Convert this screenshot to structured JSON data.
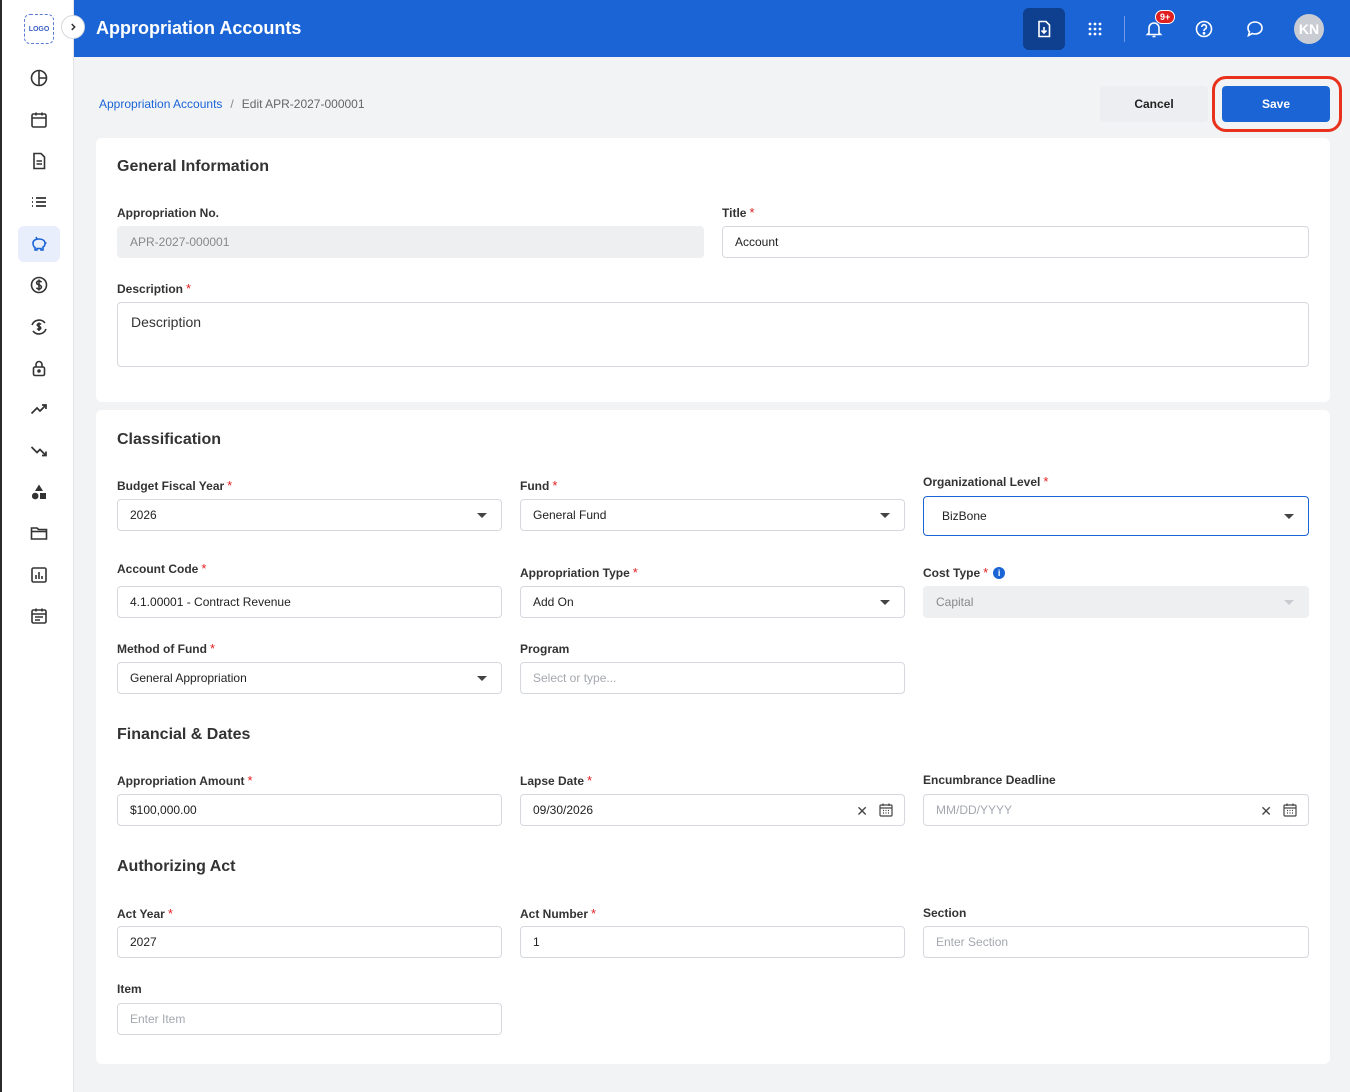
{
  "sidebar": {
    "logo_text": "LOGO",
    "icons": [
      "dashboard-icon",
      "calendar-icon",
      "document-icon",
      "list-icon",
      "piggy-bank-icon",
      "dollar-icon",
      "currency-exchange-icon",
      "lock-icon",
      "trending-up-icon",
      "trending-down-icon",
      "shapes-icon",
      "folder-icon",
      "bar-chart-icon",
      "schedule-icon"
    ],
    "active_index": 4
  },
  "header": {
    "title": "Appropriation Accounts",
    "notification_badge": "9+",
    "avatar_initials": "KN",
    "bg_color": "#1a64d6"
  },
  "breadcrumb": {
    "parent": "Appropriation Accounts",
    "separator": "/",
    "current": "Edit APR-2027-000001"
  },
  "actions": {
    "cancel_label": "Cancel",
    "save_label": "Save"
  },
  "general": {
    "section_title": "General Information",
    "appropriation_no_label": "Appropriation No.",
    "appropriation_no_value": "APR-2027-000001",
    "title_label": "Title",
    "title_value": "Account",
    "description_label": "Description",
    "description_value": "Description"
  },
  "classification": {
    "section_title": "Classification",
    "budget_fiscal_year_label": "Budget Fiscal Year",
    "budget_fiscal_year_value": "2026",
    "fund_label": "Fund",
    "fund_value": "General Fund",
    "org_level_label": "Organizational Level",
    "org_level_value": "BizBone",
    "account_code_label": "Account Code",
    "account_code_value": "4.1.00001 - Contract Revenue",
    "appropriation_type_label": "Appropriation Type",
    "appropriation_type_value": "Add On",
    "cost_type_label": "Cost Type",
    "cost_type_value": "Capital",
    "method_of_fund_label": "Method of Fund",
    "method_of_fund_value": "General Appropriation",
    "program_label": "Program",
    "program_placeholder": "Select or type..."
  },
  "financial": {
    "section_title": "Financial & Dates",
    "amount_label": "Appropriation Amount",
    "amount_value": "$100,000.00",
    "lapse_date_label": "Lapse Date",
    "lapse_date_value": "09/30/2026",
    "encumbrance_label": "Encumbrance Deadline",
    "encumbrance_placeholder": "MM/DD/YYYY"
  },
  "authorizing": {
    "section_title": "Authorizing Act",
    "act_year_label": "Act Year",
    "act_year_value": "2027",
    "act_number_label": "Act Number",
    "act_number_value": "1",
    "section_label": "Section",
    "section_placeholder": "Enter Section",
    "item_label": "Item",
    "item_placeholder": "Enter Item"
  },
  "required_mark": "*",
  "info_glyph": "i"
}
